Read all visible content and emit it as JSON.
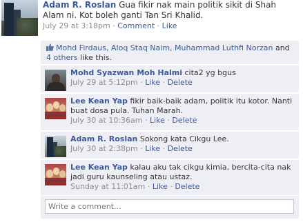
{
  "post": {
    "author": "Adam R. Roslan",
    "text": "Gua fikir nak main politik sikit di Shah Alam ni. Kot boleh ganti Tan Sri Khalid.",
    "time": "July 29 at 3:18pm",
    "comment_link": "Comment",
    "like_link": "Like"
  },
  "likes": {
    "names": "Mohd Firdaus, Aloq Staq Naim, Muhammad Luthfi Norzan",
    "and_text": "and",
    "others_link": "4 others",
    "suffix": "like this."
  },
  "comments": [
    {
      "author": "Mohd Syazwan Moh Halmi",
      "text": "cita2 yg bgus",
      "time": "July 29 at 5:12pm",
      "like": "Like",
      "delete": "Delete"
    },
    {
      "author": "Lee Kean Yap",
      "text": "fikir baik-baik adam, politik itu kotor. Nanti buat dosa pula. Tuhan Marah.",
      "time": "July 30 at 10:36am",
      "like": "Like",
      "delete": "Delete"
    },
    {
      "author": "Adam R. Roslan",
      "text": "Sokong kata Cikgu Lee.",
      "time": "July 30 at 2:38pm",
      "like": "Like",
      "delete": "Delete"
    },
    {
      "author": "Lee Kean Yap",
      "text": "kalau aku tak cikgu kimia, bercita-cita nak jadi guru kaunseling atau ustaz.",
      "time": "Sunday at 11:01am",
      "like": "Like",
      "delete": "Delete"
    }
  ],
  "write_comment": {
    "placeholder": "Write a comment..."
  },
  "colors": {
    "link": "#3b5998",
    "meta": "#8c8c8c",
    "comment_bg": "#edeff4"
  }
}
